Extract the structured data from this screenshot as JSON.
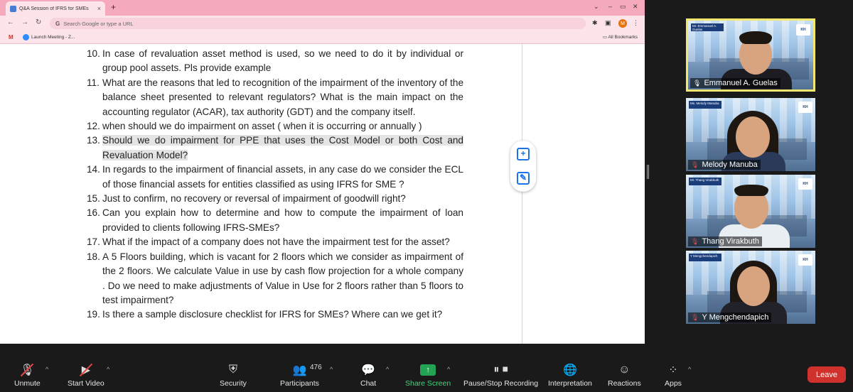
{
  "browser": {
    "tab_title": "Q&A Session of IFRS for SMEs",
    "tab_close": "×",
    "new_tab": "+",
    "omnibox_placeholder": "Search Google or type a URL",
    "avatar_letter": "M",
    "bookmarks": [
      "Launch Meeting - Z..."
    ],
    "all_bookmarks": "All Bookmarks"
  },
  "document": {
    "questions": [
      {
        "num": "10.",
        "text": "In case of revaluation asset method is used, so we need to do it by individual or group pool assets. Pls provide example"
      },
      {
        "num": "11.",
        "text": "What are the reasons that led to recognition of the impairment of  the inventory of the balance sheet presented to relevant regulators? What is  the main impact on the accounting regulator (ACAR), tax authority (GDT) and the company itself."
      },
      {
        "num": "12.",
        "text": "when should we do impairment on asset ( when it is occurring or annually )"
      },
      {
        "num": "13.",
        "text": "Should we do impairment for PPE that uses the Cost Model or both Cost and Revaluation Model?"
      },
      {
        "num": "14.",
        "text": "In regards to the impairment of financial assets, in any case do we consider the ECL of those financial assets for entities classified as using IFRS for SME ?"
      },
      {
        "num": "15.",
        "text": "Just to confirm, no recovery or reversal of impairment of goodwill right?"
      },
      {
        "num": "16.",
        "text": "Can you explain how to determine and how to compute the impairment of loan provided to clients following IFRS-SMEs?"
      },
      {
        "num": "17.",
        "text": "What if the impact of a company does not have the impairment test for the asset?"
      },
      {
        "num": "18.",
        "text": "A 5 Floors building, which is vacant for 2 floors which we consider as impairment of the 2 floors. We calculate Value in use by cash flow projection for a whole company . Do we need to make adjustments of Value in Use for 2 floors rather than 5 floors to test impairment?"
      },
      {
        "num": "19.",
        "text": "Is there a sample disclosure checklist for IFRS for SMEs? Where can we get it?"
      }
    ]
  },
  "participants_gallery": [
    {
      "name": "Emmanuel A. Guelas",
      "plate": "Mr. Emmanuel A. Guelas",
      "mic_muted": false,
      "active": true
    },
    {
      "name": "Melody Manuba",
      "plate": "Ms. Melody Manuba",
      "mic_muted": true,
      "active": false
    },
    {
      "name": "Thang Virakbuth",
      "plate": "Mr. Thang Virakbuth",
      "mic_muted": true,
      "active": false
    },
    {
      "name": "Y Mengchendapich",
      "plate": "Y Mengchendapich",
      "mic_muted": true,
      "active": false
    }
  ],
  "toolbar": {
    "unmute": "Unmute",
    "start_video": "Start Video",
    "security": "Security",
    "participants": "Participants",
    "participant_count": "476",
    "chat": "Chat",
    "share_screen": "Share Screen",
    "recording": "Pause/Stop Recording",
    "interpretation": "Interpretation",
    "reactions": "Reactions",
    "apps": "Apps",
    "leave": "Leave"
  },
  "colors": {
    "leave": "#d0312d",
    "share_green": "#23a455",
    "active_speaker": "#f2e86f"
  }
}
